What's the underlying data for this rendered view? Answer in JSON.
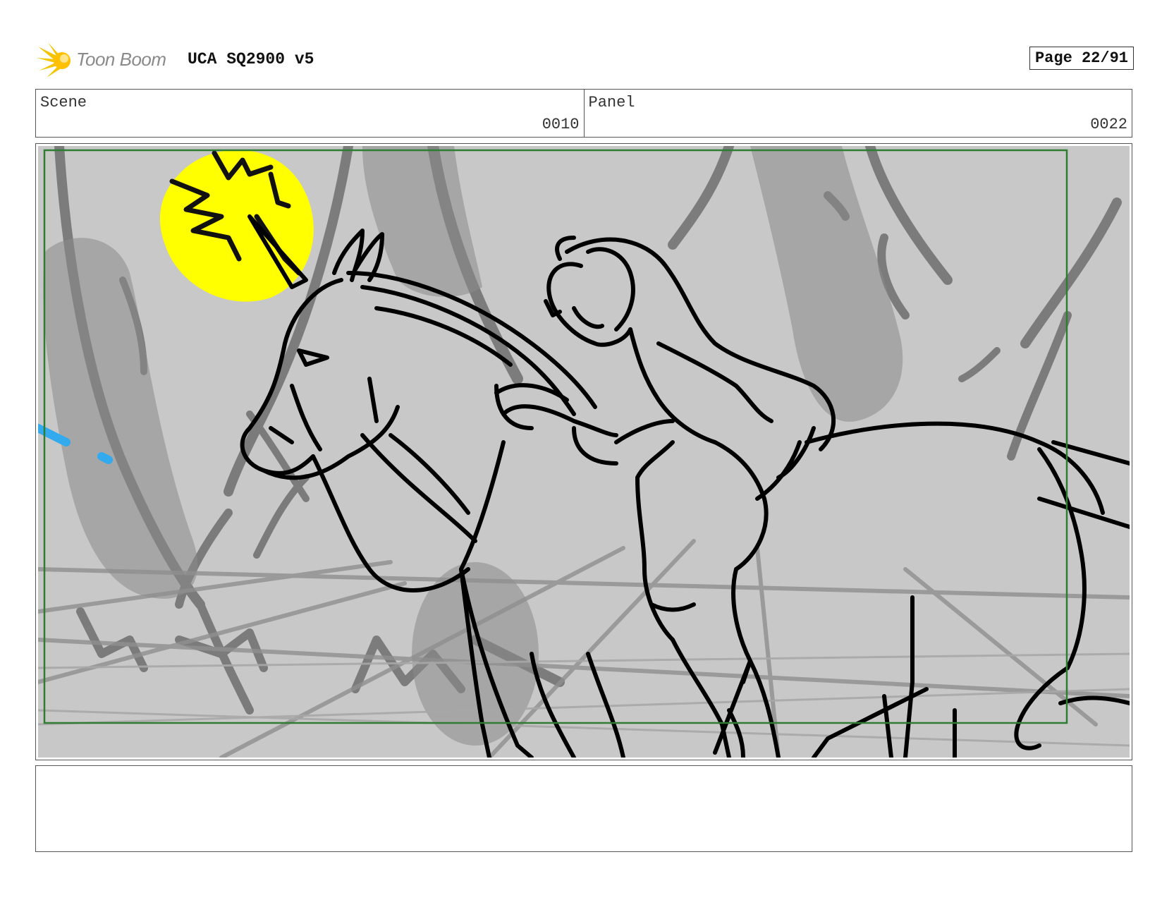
{
  "header": {
    "logo_text": "Toon Boom",
    "project_title": "UCA SQ2900 v5",
    "page_indicator": "Page 22/91"
  },
  "scene": {
    "label": "Scene",
    "value": "0010"
  },
  "panel": {
    "label": "Panel",
    "value": "0022"
  },
  "notes": {
    "text": ""
  },
  "colors": {
    "logo_accent": "#f5c400",
    "safe_area_border": "#2e7d32",
    "highlight_yellow": "#ffff00",
    "sketch_background": "#c8c8c8",
    "accent_blue": "#33aaee"
  },
  "icons": {
    "logo": "toon-boom-logo-icon"
  }
}
